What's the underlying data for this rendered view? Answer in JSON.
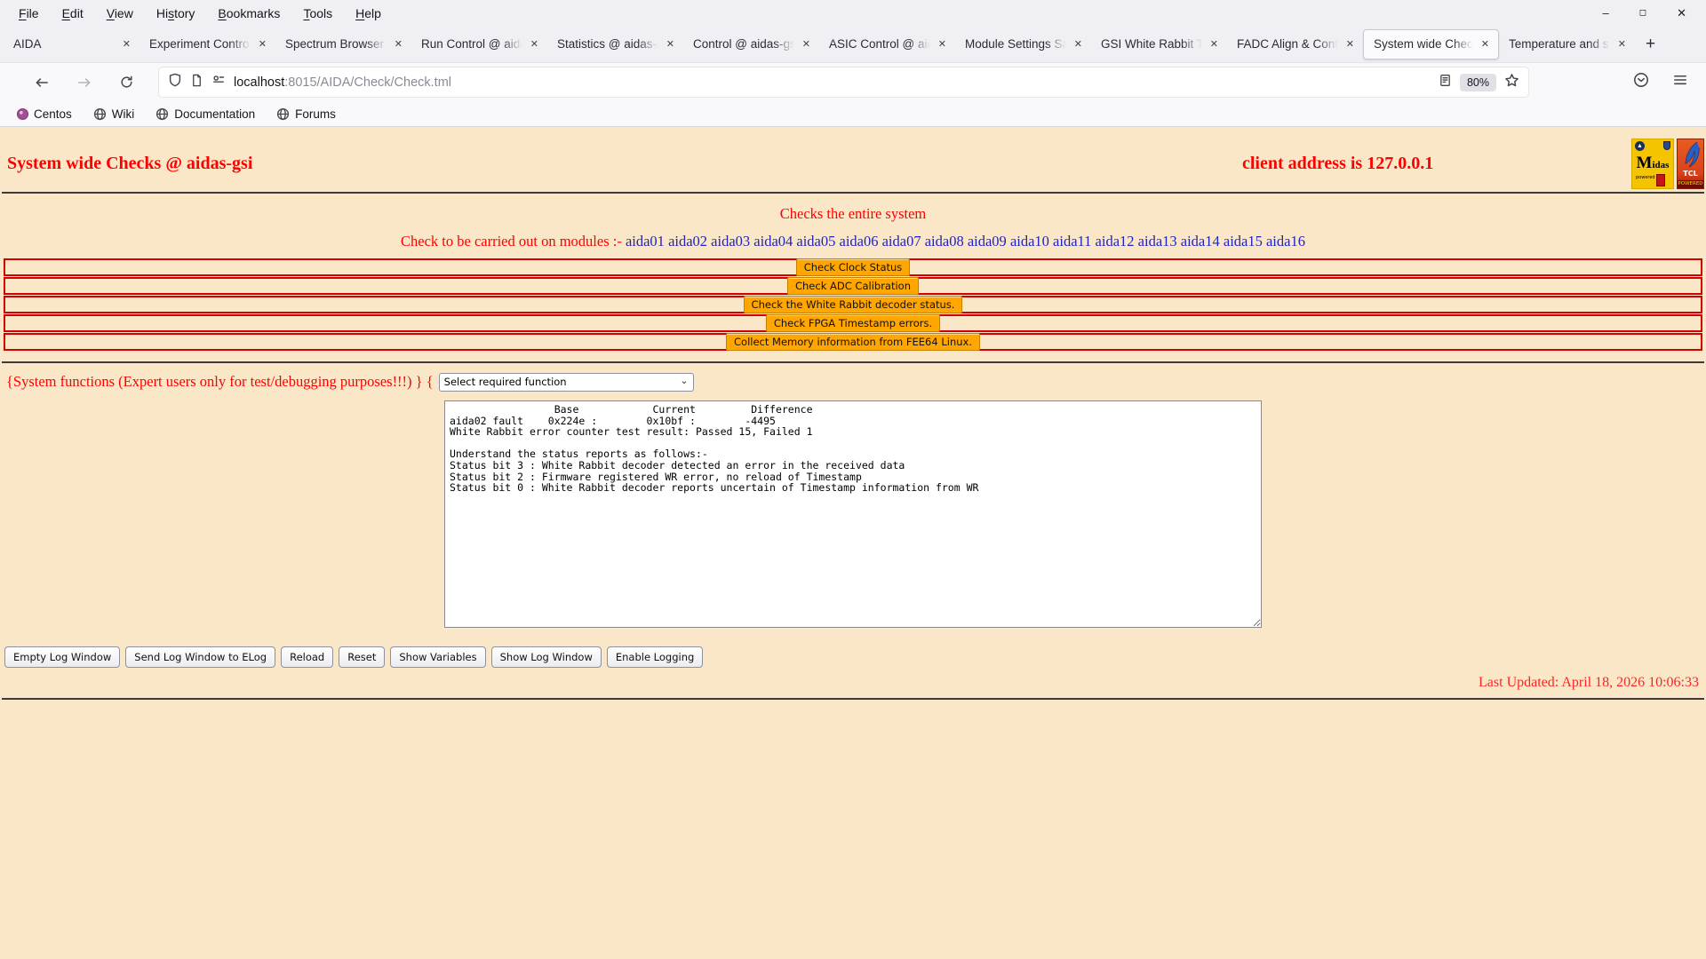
{
  "browser": {
    "menu": {
      "items": [
        {
          "pre": "",
          "accel": "F",
          "rest": "ile"
        },
        {
          "pre": "",
          "accel": "E",
          "rest": "dit"
        },
        {
          "pre": "",
          "accel": "V",
          "rest": "iew"
        },
        {
          "pre": "Hi",
          "accel": "s",
          "rest": "tory"
        },
        {
          "pre": "",
          "accel": "B",
          "rest": "ookmarks"
        },
        {
          "pre": "",
          "accel": "T",
          "rest": "ools"
        },
        {
          "pre": "",
          "accel": "H",
          "rest": "elp"
        }
      ]
    },
    "window_controls": {
      "minimize": "–",
      "maximize": "◻",
      "close": "✕"
    },
    "tab_close_glyph": "✕",
    "new_tab_glyph": "+",
    "tabs": [
      {
        "title": "AIDA"
      },
      {
        "title": "Experiment Control"
      },
      {
        "title": "Spectrum Browser"
      },
      {
        "title": "Run Control @ aida"
      },
      {
        "title": "Statistics @ aidas-g"
      },
      {
        "title": "Control @ aidas-gs"
      },
      {
        "title": "ASIC Control @ aid"
      },
      {
        "title": "Module Settings Sa"
      },
      {
        "title": "GSI White Rabbit T"
      },
      {
        "title": "FADC Align & Cont"
      },
      {
        "title": "System wide Check"
      },
      {
        "title": "Temperature and s"
      }
    ],
    "nav": {
      "url_host": "localhost",
      "url_rest": ":8015/AIDA/Check/Check.tml",
      "zoom_badge": "80%"
    },
    "bookmarks": [
      {
        "label": "Centos"
      },
      {
        "label": "Wiki"
      },
      {
        "label": "Documentation"
      },
      {
        "label": "Forums"
      }
    ]
  },
  "page": {
    "title": "System wide Checks @ aidas-gsi",
    "client_address": "client address is 127.0.0.1",
    "subtitle": "Checks the entire system",
    "modules_prefix": "Check to be carried out on modules :-",
    "modules": [
      "aida01",
      "aida02",
      "aida03",
      "aida04",
      "aida05",
      "aida06",
      "aida07",
      "aida08",
      "aida09",
      "aida10",
      "aida11",
      "aida12",
      "aida13",
      "aida14",
      "aida15",
      "aida16"
    ],
    "check_buttons": [
      "Check Clock Status",
      "Check ADC Calibration",
      "Check the White Rabbit decoder status.",
      "Check FPGA Timestamp errors.",
      "Collect Memory information from FEE64 Linux."
    ],
    "system_functions_label": "{System functions (Expert users only for test/debugging purposes!!!)  } {",
    "function_select_value": "Select required function",
    "log_text": "                 Base            Current         Difference\naida02 fault    0x224e :        0x10bf :        -4495\nWhite Rabbit error counter test result: Passed 15, Failed 1\n\nUnderstand the status reports as follows:-\nStatus bit 3 : White Rabbit decoder detected an error in the received data\nStatus bit 2 : Firmware registered WR error, no reload of Timestamp\nStatus bit 0 : White Rabbit decoder reports uncertain of Timestamp information from WR",
    "log_buttons": [
      "Empty Log Window",
      "Send Log Window to ELog",
      "Reload",
      "Reset",
      "Show Variables",
      "Show Log Window",
      "Enable Logging"
    ],
    "last_updated": "Last Updated: April 18, 2026 10:06:33",
    "logos": {
      "midas_m": "M",
      "midas_rest": "idas",
      "midas_powered": "powered by",
      "tcl_title": "TCL",
      "tcl_powered": "POWERED"
    }
  },
  "colors": {
    "page_bg": "#fae7c7",
    "accent_red": "#ff0000",
    "link_blue": "#2323bd",
    "button_orange": "#ffa600",
    "row_border_red": "#d40000"
  }
}
